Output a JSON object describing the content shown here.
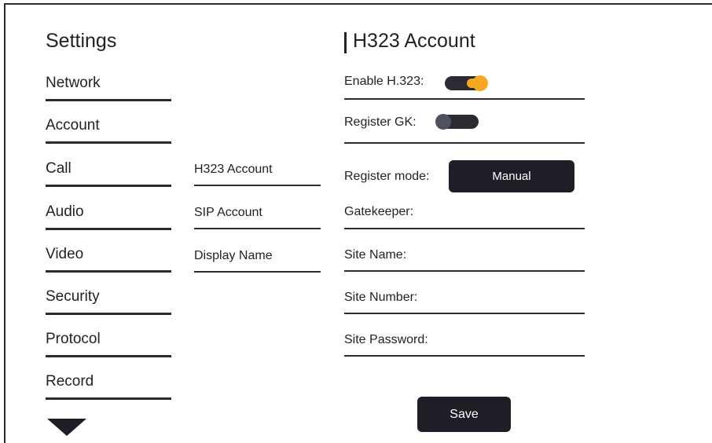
{
  "sidebar": {
    "title": "Settings",
    "items": [
      {
        "label": "Network"
      },
      {
        "label": "Account"
      },
      {
        "label": "Call"
      },
      {
        "label": "Audio"
      },
      {
        "label": "Video"
      },
      {
        "label": "Security"
      },
      {
        "label": "Protocol"
      },
      {
        "label": "Record"
      }
    ],
    "more_icon": "triangle-down-icon"
  },
  "submenu": {
    "items": [
      {
        "label": "H323 Account"
      },
      {
        "label": "SIP Account"
      },
      {
        "label": "Display Name"
      }
    ]
  },
  "panel": {
    "title": "H323 Account",
    "enable_h323": {
      "label": "Enable H.323:",
      "state": "on"
    },
    "register_gk": {
      "label": "Register GK:",
      "state": "off"
    },
    "register_mode": {
      "label": "Register mode:",
      "value": "Manual"
    },
    "gatekeeper": {
      "label": "Gatekeeper:"
    },
    "site_name": {
      "label": "Site Name:"
    },
    "site_number": {
      "label": "Site Number:"
    },
    "site_password": {
      "label": "Site Password:"
    },
    "save_label": "Save"
  },
  "colors": {
    "accent": "#f5a623",
    "dark": "#1e1f26",
    "toggle_off_knob": "#4e5160"
  }
}
